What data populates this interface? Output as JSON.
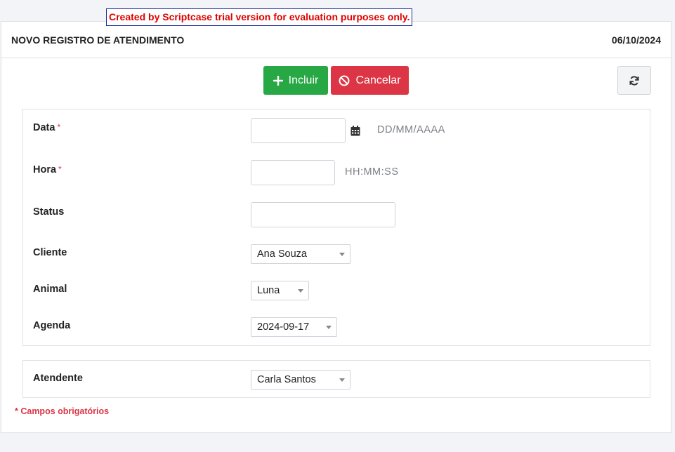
{
  "trial_banner": "Created by Scriptcase trial version for evaluation purposes only.",
  "header": {
    "title": "NOVO REGISTRO DE ATENDIMENTO",
    "date": "06/10/2024"
  },
  "toolbar": {
    "incluir_label": "Incluir",
    "cancelar_label": "Cancelar",
    "icons": {
      "incluir": "plus-icon",
      "cancelar": "ban-icon",
      "refresh": "refresh-icon"
    }
  },
  "form": {
    "data": {
      "label": "Data",
      "required_mark": "*",
      "value": "",
      "hint": "DD/MM/AAAA",
      "icon": "calendar-icon"
    },
    "hora": {
      "label": "Hora",
      "required_mark": "*",
      "value": "",
      "hint": "HH:MM:SS"
    },
    "status": {
      "label": "Status",
      "value": ""
    },
    "cliente": {
      "label": "Cliente",
      "selected": "Ana Souza"
    },
    "animal": {
      "label": "Animal",
      "selected": "Luna"
    },
    "agenda": {
      "label": "Agenda",
      "selected": "2024-09-17"
    },
    "atendente": {
      "label": "Atendente",
      "selected": "Carla Santos"
    }
  },
  "footer": {
    "required_note": "* Campos obrigatórios"
  },
  "colors": {
    "incluir": "#28a745",
    "cancelar": "#dc3545",
    "required": "#dc3545",
    "banner_text": "#e00000"
  }
}
